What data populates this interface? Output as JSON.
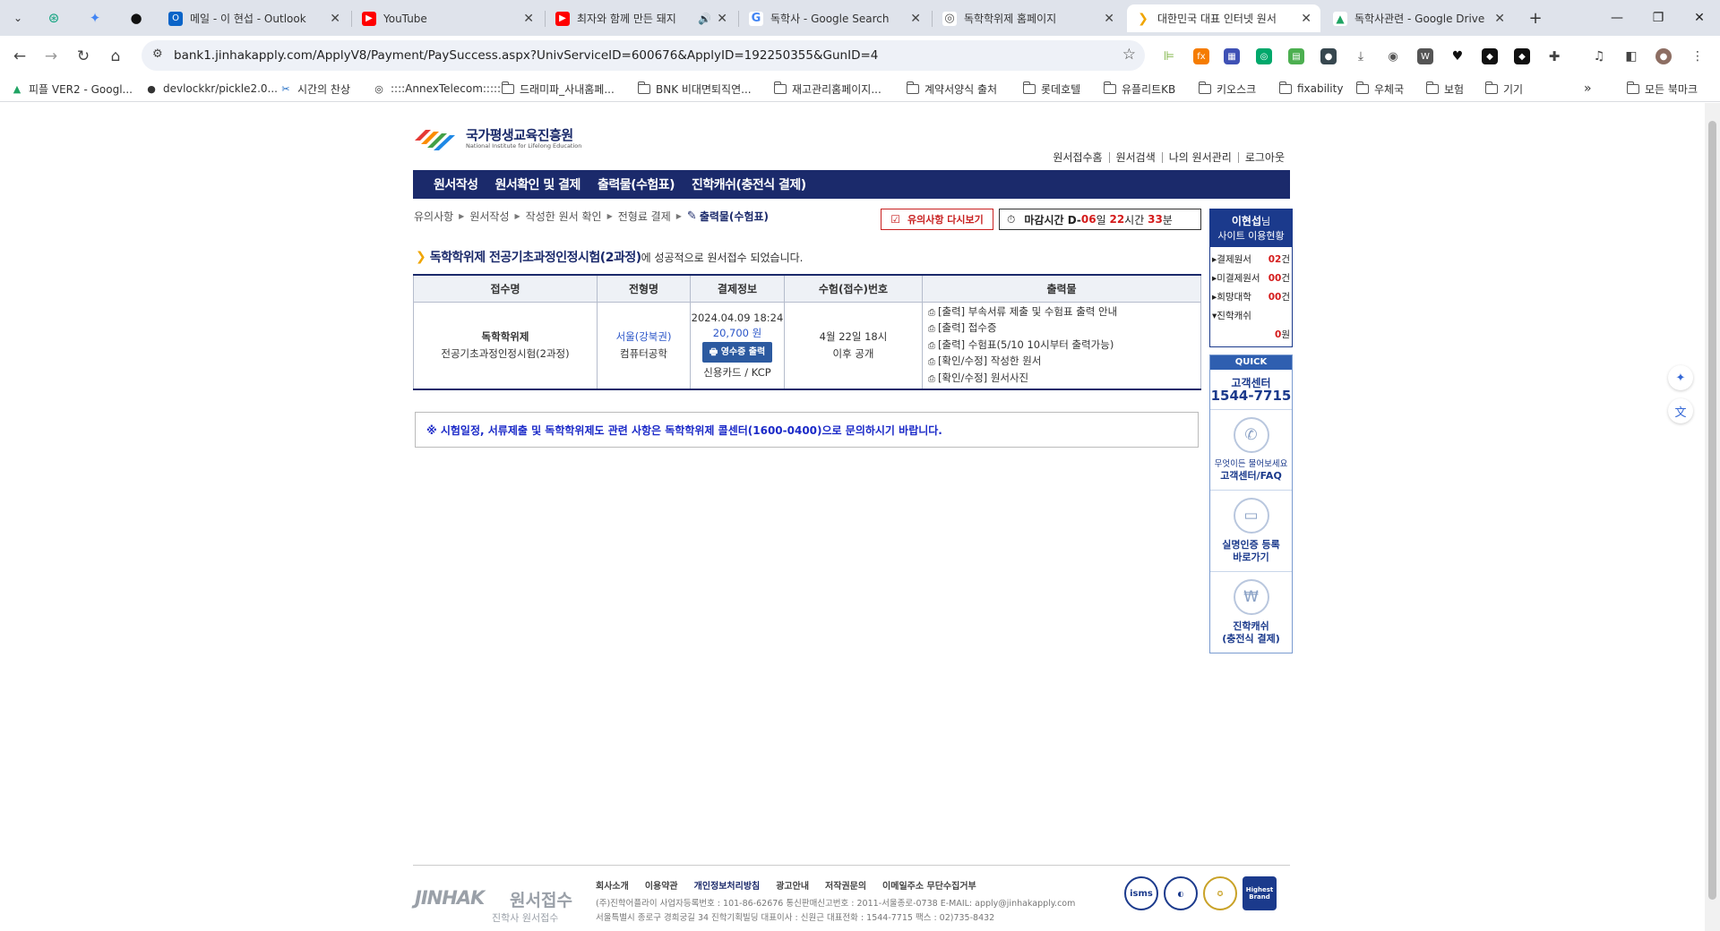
{
  "browser": {
    "tabs": [
      {
        "title": "메일 - 이 현섭 - Outlook",
        "favicon": "outlook-icon",
        "active": false
      },
      {
        "title": "YouTube",
        "favicon": "youtube-icon",
        "active": false
      },
      {
        "title": "최자와 함께 만든 돼지",
        "favicon": "youtube-icon",
        "active": false
      },
      {
        "title": "독학사 - Google Search",
        "favicon": "google-icon",
        "active": false
      },
      {
        "title": "독학학위제 홈페이지",
        "favicon": "globe-icon",
        "active": false
      },
      {
        "title": "대한민국 대표 인터넷 원서",
        "favicon": "jinhak-icon",
        "active": true
      },
      {
        "title": "독학사관련 - Google Drive",
        "favicon": "drive-icon",
        "active": false
      }
    ],
    "url": "bank1.jinhakapply.com/ApplyV8/Payment/PaySuccess.aspx?UnivServiceID=600676&ApplyID=192250355&GunID=4",
    "bookmarks": [
      "피플 VER2 - Googl...",
      "devlockkr/pickle2.0...",
      "시간의 찬상",
      "::::AnnexTelecom:::::",
      "드래미파_사내홈페...",
      "BNK 비대면퇴직연...",
      "재고관리홈페이지...",
      "계약서양식 출처",
      "롯데호텔",
      "유플리트KB",
      "키오스크",
      "fixability",
      "우체국",
      "보험",
      "기기"
    ],
    "all_bookmarks": "모든 북마크"
  },
  "site": {
    "logo_kr": "국가평생교육진흥원",
    "logo_en": "National Institute for Lifelong Education",
    "util_nav": [
      "원서접수홈",
      "원서검색",
      "나의 원서관리",
      "로그아웃"
    ],
    "main_nav": [
      "원서작성",
      "원서확인 및 결제",
      "출력물(수험표)",
      "진학캐쉬(충전식 결제)"
    ],
    "breadcrumbs": [
      "유의사항",
      "원서작성",
      "작성한 원서 확인",
      "전형료 결제"
    ],
    "breadcrumb_current": "출력물(수험표)",
    "notice_button": "유의사항 다시보기",
    "deadline": {
      "label": "마감시간 D-",
      "days": "06",
      "day_unit": "일",
      "hours": "22",
      "hour_unit": "시간",
      "minutes": "33",
      "min_unit": "분"
    },
    "headline": {
      "exam": "독학학위제 전공기초과정인정시험(2과정)",
      "suffix": "에 성공적으로 원서접수 되었습니다."
    },
    "table": {
      "headers": [
        "접수명",
        "전형명",
        "결제정보",
        "수험(접수)번호",
        "출력물"
      ],
      "row": {
        "name_bold": "독학학위제",
        "name_sub": "전공기초과정인정시험(2과정)",
        "region": "서울(강북권)",
        "major": "컴퓨터공학",
        "pay_date": "2024.04.09 18:24",
        "pay_amount": "20,700 원",
        "receipt_button": "영수증 출력",
        "pay_method": "신용카드 / KCP",
        "exam_no_line1": "4월 22일 18시",
        "exam_no_line2": "이후 공개",
        "outputs": [
          "[출력] 부속서류 제출 및 수험표 출력 안내",
          "[출력] 접수증",
          "[출력] 수험표(5/10 10시부터 출력가능)",
          "[확인/수정] 작성한 원서",
          "[확인/수정] 원서사진"
        ]
      }
    },
    "contact_notice": "※ 시험일정, 서류제출 및 독학학위제도 관련 사항은 독학학위제 콜센터(1600-0400)으로 문의하시기 바랍니다.",
    "side": {
      "user_name": "이현섭",
      "user_suffix": "님",
      "user_sub": "사이트 이용현황",
      "stats": [
        {
          "label": "결제원서",
          "value": "02",
          "unit": "건"
        },
        {
          "label": "미결제원서",
          "value": "00",
          "unit": "건"
        },
        {
          "label": "희망대학",
          "value": "00",
          "unit": "건"
        },
        {
          "label": "진학캐쉬",
          "value": "",
          "unit": ""
        }
      ],
      "cash_value": "0",
      "cash_unit": "원",
      "quick": "QUICK",
      "cs_title": "고객센터",
      "cs_phone": "1544-7715",
      "faq_sub": "무엇이든 물어보세요",
      "faq_title": "고객센터/FAQ",
      "verify_title": "실명인증 등록",
      "verify_sub": "바로가기",
      "cash_title": "진학캐쉬",
      "cash_sub": "(충전식 결제)"
    },
    "footer": {
      "logo": "JINHAK",
      "logo_kr": "원서접수",
      "logo_sub": "진학사 원서접수",
      "links": [
        "회사소개",
        "이용약관",
        "개인정보처리방침",
        "광고안내",
        "저작권문의",
        "이메일주소 무단수집거부"
      ],
      "info1": "(주)진학어플라이 사업자등록번호 : 101-86-62676  통신판매신고번호 : 2011-서울종로-0738  E-MAIL: apply@jinhakapply.com",
      "info2": "서울특별시 종로구 경희궁길 34 진학기획빌딩   대표이사 : 신원근   대표전화 : 1544-7715   팩스 : 02)735-8432",
      "badges": [
        "isms",
        "",
        "",
        "Highest Brand"
      ]
    }
  }
}
